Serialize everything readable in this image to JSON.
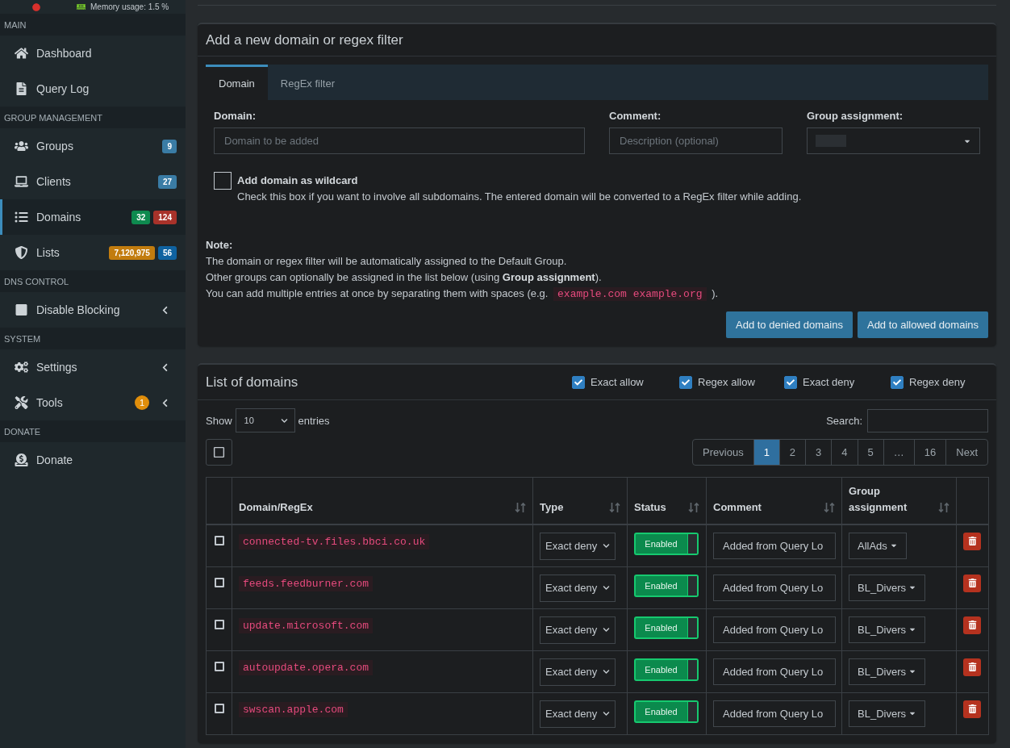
{
  "sidebar": {
    "memory": "Memory usage: 1.5 %",
    "sections": [
      {
        "title": "MAIN",
        "items": [
          {
            "label": "Dashboard",
            "kind": "link",
            "selected": false
          },
          {
            "label": "Query Log",
            "kind": "link",
            "selected": false
          }
        ]
      },
      {
        "title": "GROUP MANAGEMENT",
        "items": [
          {
            "label": "Groups",
            "kind": "link",
            "selected": false,
            "badges": [
              {
                "text": "9",
                "color": "#3a7ca5",
                "kind": "label"
              }
            ]
          },
          {
            "label": "Clients",
            "kind": "link",
            "selected": false,
            "badges": [
              {
                "text": "27",
                "color": "#3a7ca5",
                "kind": "label"
              }
            ]
          },
          {
            "label": "Domains",
            "kind": "link",
            "selected": true,
            "badges": [
              {
                "text": "32",
                "color": "#0e8a4f",
                "kind": "label"
              },
              {
                "text": "124",
                "color": "#a8322a",
                "kind": "label"
              }
            ]
          },
          {
            "label": "Lists",
            "kind": "link",
            "selected": false,
            "badges": [
              {
                "text": "7,120,975",
                "color": "#c27c0e",
                "kind": "label"
              },
              {
                "text": "56",
                "color": "#0f62a0",
                "kind": "label"
              }
            ]
          }
        ]
      },
      {
        "title": "DNS CONTROL",
        "items": [
          {
            "label": "Disable Blocking",
            "kind": "tree",
            "selected": false,
            "expanded": false
          }
        ]
      },
      {
        "title": "SYSTEM",
        "items": [
          {
            "label": "Settings",
            "kind": "tree",
            "selected": false,
            "expanded": false
          },
          {
            "label": "Tools",
            "kind": "tree",
            "selected": false,
            "expanded": false,
            "badges": [
              {
                "text": "1",
                "color": "#e08e0b",
                "kind": "circle"
              }
            ]
          }
        ]
      },
      {
        "title": "DONATE",
        "items": [
          {
            "label": "Donate",
            "kind": "link",
            "selected": false
          }
        ]
      }
    ]
  },
  "add_form": {
    "title": "Add a new domain or regex filter",
    "tabs": [
      {
        "label": "Domain",
        "selected": true
      },
      {
        "label": "RegEx filter",
        "selected": false
      }
    ],
    "fields": [
      {
        "label": "Domain:",
        "kind": "input",
        "placeholder": "Domain to be added"
      },
      {
        "label": "Comment:",
        "kind": "input",
        "placeholder": "Description (optional)"
      },
      {
        "label": "Group assignment:",
        "kind": "select"
      }
    ],
    "wildcard": {
      "label": "Add domain as wildcard",
      "checked": false,
      "help": "Check this box if you want to involve all subdomains. The entered domain will be converted to a RegEx filter while adding."
    },
    "note": {
      "title": "Note:",
      "lines": [
        "The domain or regex filter will be automatically assigned to the Default Group.",
        "Other groups can optionally be assigned in the list below (using **Group assignment**)."
      ],
      "example": {
        "before": "You can add multiple entries at once by separating them with spaces (e.g.",
        "code": "example.com example.org",
        "after": ")."
      }
    },
    "buttons": [
      "Add to denied domains",
      "Add to allowed domains"
    ]
  },
  "domain_list": {
    "title": "List of domains",
    "filters": [
      {
        "label": "Exact allow",
        "checked": true
      },
      {
        "label": "Regex allow",
        "checked": true
      },
      {
        "label": "Exact deny",
        "checked": true
      },
      {
        "label": "Regex deny",
        "checked": true
      }
    ],
    "length": {
      "before": "Show",
      "value": "10",
      "after": "entries"
    },
    "search": {
      "label": "Search:"
    },
    "select_all": {
      "checked": false
    },
    "pagination": [
      {
        "label": "Previous",
        "selected": false
      },
      {
        "label": "1",
        "selected": true
      },
      {
        "label": "2",
        "selected": false
      },
      {
        "label": "3",
        "selected": false
      },
      {
        "label": "4",
        "selected": false
      },
      {
        "label": "5",
        "selected": false
      },
      {
        "label": "…",
        "selected": false
      },
      {
        "label": "16",
        "selected": false
      },
      {
        "label": "Next",
        "selected": false
      }
    ],
    "table": {
      "columns": [
        "Domain/RegEx",
        "Type",
        "Status",
        "Comment",
        "Group assignment"
      ],
      "rows": [
        {
          "checked": false,
          "domain": "connected-tv.files.bbci.co.uk",
          "type": "Exact deny",
          "enabled": true,
          "status": "Enabled",
          "comment": "Added from Query Lo",
          "group": "AllAds"
        },
        {
          "checked": false,
          "domain": "feeds.feedburner.com",
          "type": "Exact deny",
          "enabled": true,
          "status": "Enabled",
          "comment": "Added from Query Lo",
          "group": "BL_Divers"
        },
        {
          "checked": false,
          "domain": "update.microsoft.com",
          "type": "Exact deny",
          "enabled": true,
          "status": "Enabled",
          "comment": "Added from Query Lo",
          "group": "BL_Divers"
        },
        {
          "checked": false,
          "domain": "autoupdate.opera.com",
          "type": "Exact deny",
          "enabled": true,
          "status": "Enabled",
          "comment": "Added from Query Lo",
          "group": "BL_Divers"
        },
        {
          "checked": false,
          "domain": "swscan.apple.com",
          "type": "Exact deny",
          "enabled": true,
          "status": "Enabled",
          "comment": "Added from Query Lo",
          "group": "BL_Divers"
        }
      ]
    }
  }
}
